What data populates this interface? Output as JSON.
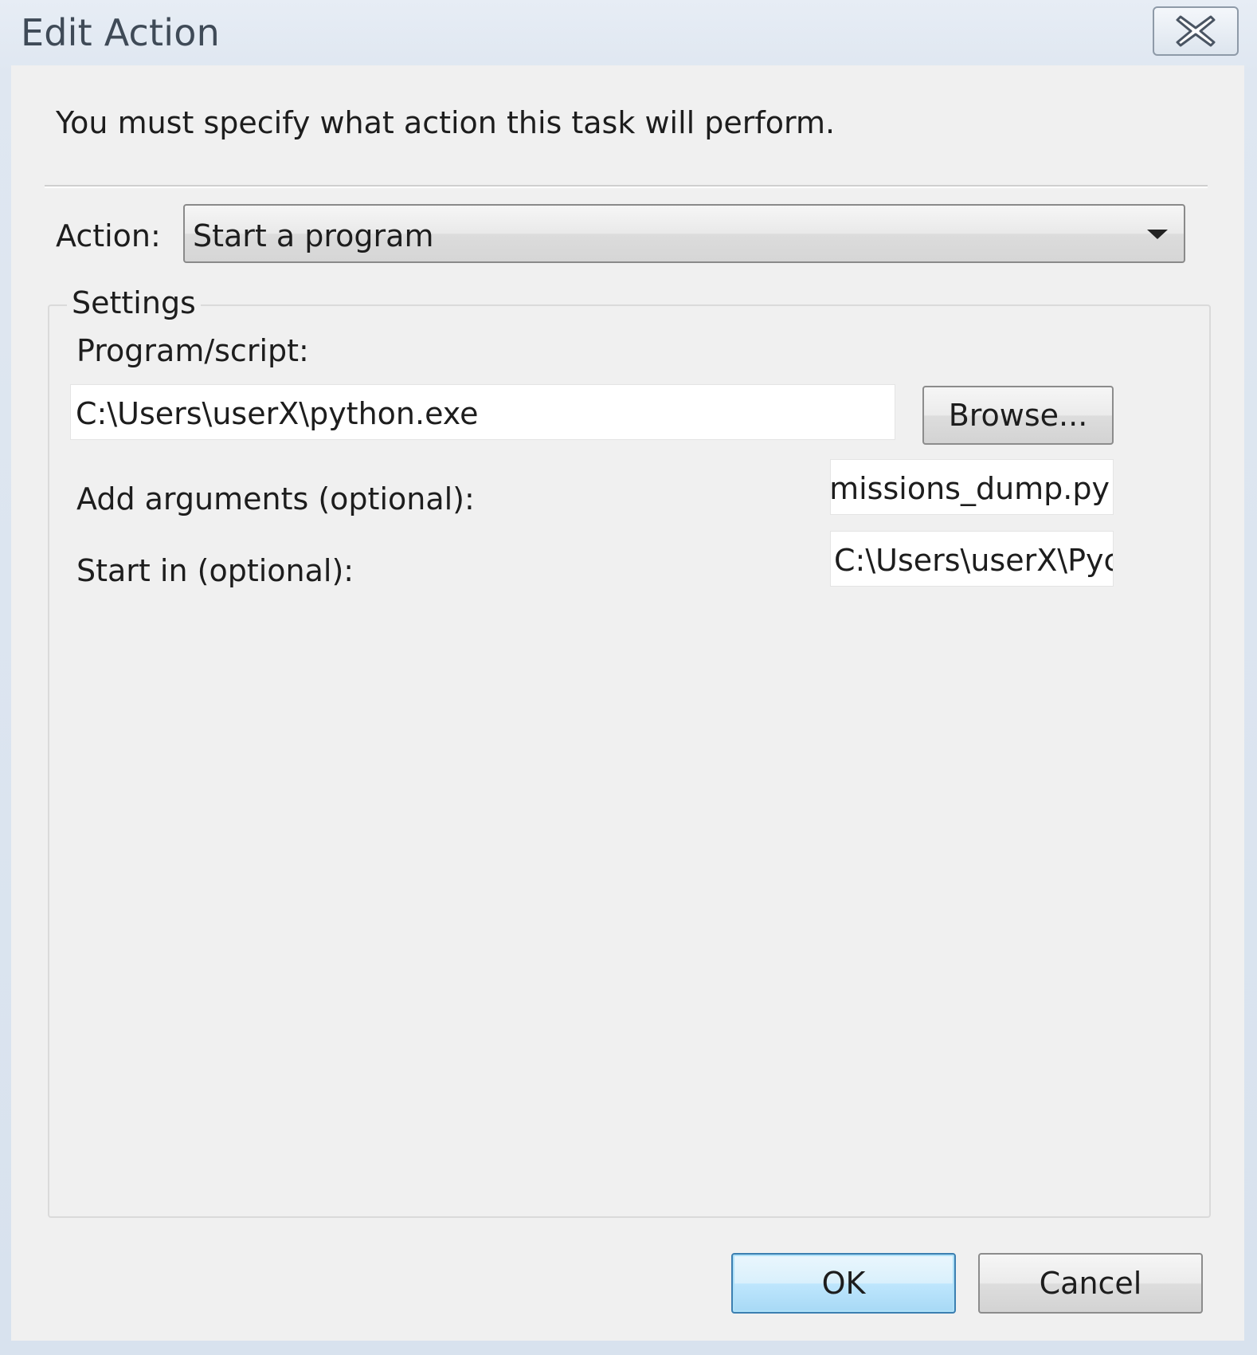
{
  "window": {
    "title": "Edit Action"
  },
  "icons": {
    "close": "close-icon",
    "dropdown": "chevron-down-icon"
  },
  "main": {
    "instruction": "You must specify what action this task will perform.",
    "action_label": "Action:",
    "action_value": "Start a program",
    "settings": {
      "legend": "Settings",
      "program_label": "Program/script:",
      "program_value": "C:\\Users\\userX\\python.exe",
      "browse_label": "Browse...",
      "arguments_label": "Add arguments (optional):",
      "arguments_visible_text": "ermissions_dump.py",
      "start_in_label": "Start in (optional):",
      "start_in_visible_text": "C:\\Users\\userX\\Pych"
    }
  },
  "footer": {
    "ok_label": "OK",
    "cancel_label": "Cancel"
  },
  "colors": {
    "client_background": "#f0f0f0",
    "default_button_border": "#3c7fb1",
    "title_text": "#3f4a57"
  }
}
